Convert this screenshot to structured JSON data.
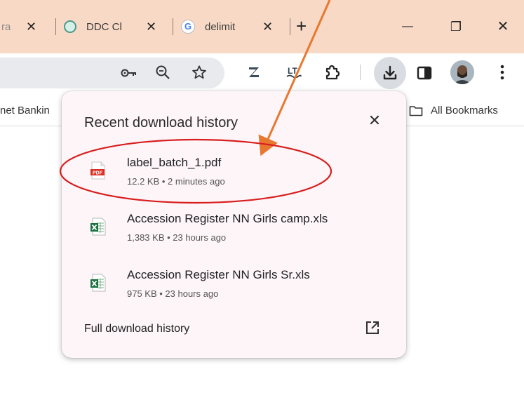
{
  "tabs": [
    {
      "title": "ra",
      "close": "✕"
    },
    {
      "title": "DDC Cl",
      "close": "✕"
    },
    {
      "title": "delimit",
      "close": "✕"
    }
  ],
  "new_tab": "+",
  "window_controls": {
    "minimize": "—",
    "restore": "❐",
    "close": "✕"
  },
  "toolbar": {
    "icons": [
      "key-icon",
      "zoom-icon",
      "star-icon",
      "z-extension-icon",
      "languagetool-icon",
      "puzzle-icon",
      "download-icon",
      "side-panel-icon",
      "avatar",
      "menu-icon"
    ],
    "lt_label": "LT"
  },
  "bookmarks": {
    "left_item": "net Bankin",
    "all_bookmarks": "All Bookmarks"
  },
  "download_bubble": {
    "title": "Recent download history",
    "close": "✕",
    "items": [
      {
        "name": "label_batch_1.pdf",
        "meta": "12.2 KB • 2 minutes ago",
        "icon": "pdf-file-icon"
      },
      {
        "name": "Accession Register NN Girls camp.xls",
        "meta": "1,383 KB • 23 hours ago",
        "icon": "excel-file-icon"
      },
      {
        "name": "Accession Register NN Girls Sr.xls",
        "meta": "975 KB • 23 hours ago",
        "icon": "excel-file-icon"
      }
    ],
    "full_history": "Full download history",
    "pdf_badge": "PDF"
  },
  "colors": {
    "tabstrip": "#f8d9c6",
    "arrow": "#e8782f",
    "ellipse": "#d81e1e",
    "bubble_bg": "#fdf5f8"
  }
}
